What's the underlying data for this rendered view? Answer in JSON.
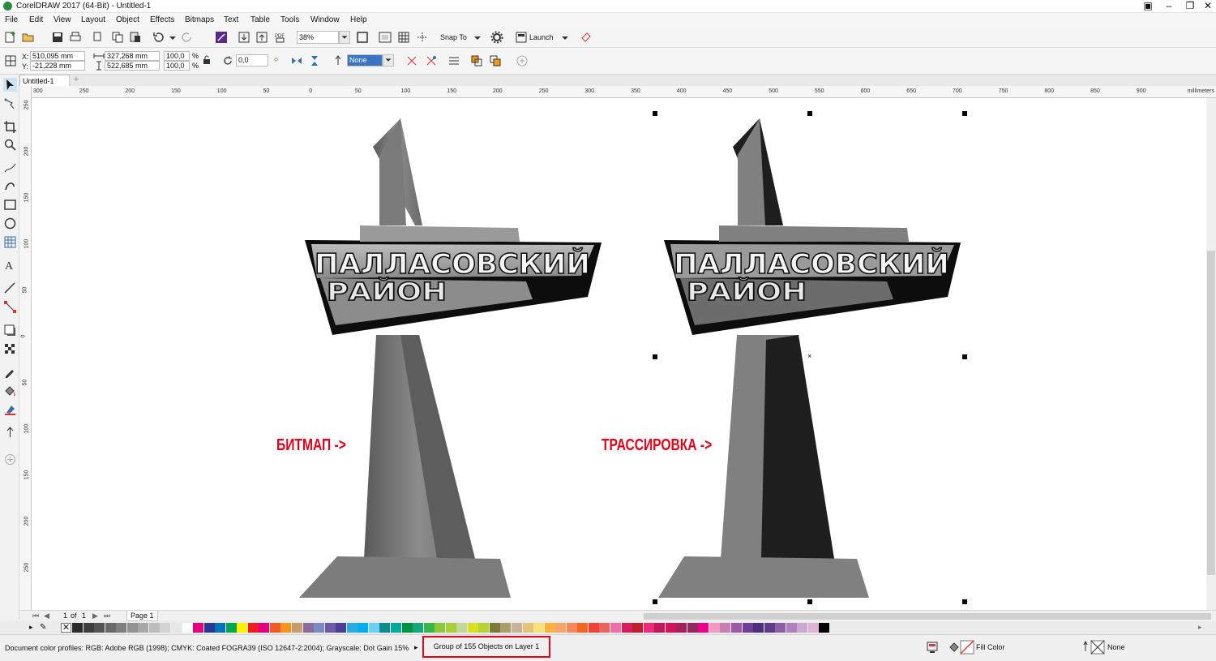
{
  "app": {
    "title": "CorelDRAW 2017 (64-Bit) - Untitled-1"
  },
  "menu": [
    "File",
    "Edit",
    "View",
    "Layout",
    "Object",
    "Effects",
    "Bitmaps",
    "Text",
    "Table",
    "Tools",
    "Window",
    "Help"
  ],
  "toolbar": {
    "zoom": "38%",
    "snap_to": "Snap To",
    "launch": "Launch"
  },
  "properties": {
    "x_label": "X:",
    "x": "510,095 mm",
    "y_label": "Y:",
    "y": "-21,228 mm",
    "width": "327,268 mm",
    "height": "522,685 mm",
    "scale_w": "100,0",
    "scale_h": "100,0",
    "pct": "%",
    "rotation": "0,0",
    "outline": "None"
  },
  "tabs": {
    "document": "Untitled-1"
  },
  "ruler": {
    "units": "millimeters",
    "h_ticks": [
      "300",
      "250",
      "200",
      "150",
      "100",
      "50",
      "0",
      "50",
      "100",
      "150",
      "200",
      "250",
      "300",
      "350",
      "400",
      "450",
      "500",
      "550",
      "600",
      "650",
      "700",
      "750",
      "800",
      "850",
      "900"
    ],
    "v_ticks": [
      "250",
      "200",
      "150",
      "100",
      "50",
      "0",
      "50",
      "100",
      "150",
      "200",
      "250"
    ]
  },
  "canvas": {
    "left_sign_line1": "ПАЛЛАСОВСКИЙ",
    "left_sign_line2": "РАЙОН",
    "right_sign_line1": "ПАЛЛАСОВСКИЙ",
    "right_sign_line2": "РАЙОН",
    "label_bitmap": "БИТМАП ->",
    "label_trace": "ТРАССИРОВКА ->"
  },
  "page_nav": {
    "current": "1",
    "of": "of",
    "total": "1",
    "page_tab": "Page 1"
  },
  "palette": [
    "#2b2b2b",
    "#3f3f3f",
    "#545454",
    "#696969",
    "#7e7e7e",
    "#939393",
    "#a8a8a8",
    "#bdbdbd",
    "#d2d2d2",
    "#e7e7e7",
    "#ffffff",
    "#e6007e",
    "#2a3990",
    "#0072bc",
    "#00a650",
    "#fff200",
    "#ed1c24",
    "#e4007c",
    "#f15a24",
    "#f7941d",
    "#c69c6d",
    "#8b6b9e",
    "#7f88c2",
    "#6a5aa8",
    "#4b3f91",
    "#29abe2",
    "#00aeef",
    "#6dcff6",
    "#0f8a8f",
    "#00a99d",
    "#009245",
    "#1aa67a",
    "#39b54a",
    "#8cc63f",
    "#a6ce39",
    "#c3d69b",
    "#d9e021",
    "#b5d334",
    "#7a7a3a",
    "#a89f6b",
    "#c7b299",
    "#e2c57c",
    "#f7e27a",
    "#fbb040",
    "#f5a66c",
    "#f7885a",
    "#f26522",
    "#ef4136",
    "#e8655e",
    "#f06eaa",
    "#d91c5c",
    "#be1e2d",
    "#ee2a7b",
    "#c2185b",
    "#d4145a",
    "#a3215c",
    "#8e2a5e",
    "#ec008c",
    "#f49ac1",
    "#c77fb3",
    "#9e5aa8",
    "#6f3f98",
    "#4f2d7f",
    "#5c3b8a",
    "#8a5fa8",
    "#b07fbe",
    "#cba8d1",
    "#e0b4d6",
    "#000000"
  ],
  "status": {
    "profiles": "Document color profiles: RGB: Adobe RGB (1998); CMYK: Coated FOGRA39 (ISO 12647-2:2004); Grayscale: Dot Gain 15%",
    "selection": "Group of 155 Objects on Layer 1",
    "fill": "Fill Color",
    "outline": "None"
  }
}
